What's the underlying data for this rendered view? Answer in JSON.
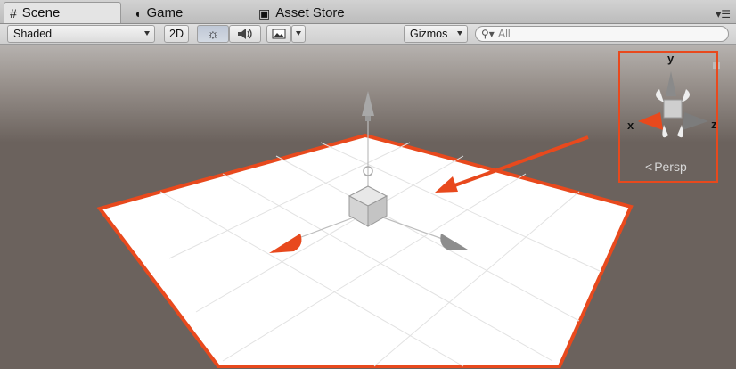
{
  "tabs": [
    {
      "label": "Scene",
      "icon": "grid-icon",
      "active": true
    },
    {
      "label": "Game",
      "icon": "pacman-icon",
      "active": false
    },
    {
      "label": "Asset Store",
      "icon": "bag-icon",
      "active": false
    }
  ],
  "toolbar": {
    "shading_mode": "Shaded",
    "mode_2d": "2D",
    "lighting_icon": "sun-icon",
    "audio_icon": "speaker-icon",
    "effects_icon": "image-icon",
    "gizmos_label": "Gizmos",
    "search_placeholder": "All"
  },
  "scene_gizmo": {
    "axis_labels": {
      "y": "y",
      "x": "x",
      "z": "z"
    },
    "projection_label": "Persp",
    "lock_icon": "lock-icon"
  },
  "colors": {
    "highlight": "#e8491d",
    "x_axis": "#e8491d",
    "ground": "#ffffff",
    "background": "#6b625d"
  }
}
